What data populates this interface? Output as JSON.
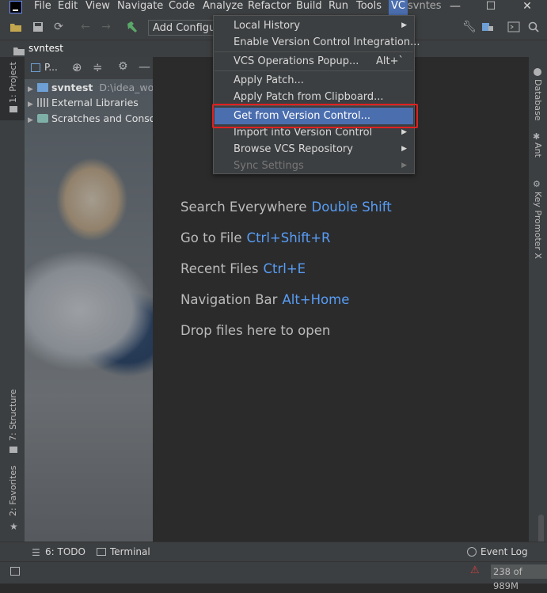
{
  "menubar": {
    "items": [
      "File",
      "Edit",
      "View",
      "Navigate",
      "Code",
      "Analyze",
      "Refactor",
      "Build",
      "Run",
      "Tools",
      "VC"
    ],
    "project_title": "svntes",
    "minimize": "—",
    "maximize": "☐",
    "close": "✕"
  },
  "toolbar": {
    "add_config_label": "Add Configur"
  },
  "breadcrumb": {
    "project": "svntest"
  },
  "left_tabs": {
    "project": "1: Project",
    "structure": "7: Structure",
    "favorites": "2: Favorites"
  },
  "project_pane": {
    "view_label": "P...",
    "tree": [
      {
        "label": "svntest",
        "path": "D:\\idea_work"
      },
      {
        "label": "External Libraries"
      },
      {
        "label": "Scratches and Conso"
      }
    ]
  },
  "editor": {
    "hints": [
      {
        "text": "Search Everywhere",
        "key": "Double Shift"
      },
      {
        "text": "Go to File",
        "key": "Ctrl+Shift+R"
      },
      {
        "text": "Recent Files",
        "key": "Ctrl+E"
      },
      {
        "text": "Navigation Bar",
        "key": "Alt+Home"
      },
      {
        "text": "Drop files here to open",
        "key": ""
      }
    ]
  },
  "right_tabs": {
    "database": "Database",
    "ant": "Ant",
    "key_promoter": "Key Promoter X"
  },
  "vcs_menu": {
    "items": [
      {
        "label": "Local History",
        "submenu": true,
        "shortcut": "",
        "disabled": false,
        "selected": false
      },
      {
        "label": "Enable Version Control Integration...",
        "submenu": false,
        "shortcut": "",
        "disabled": false,
        "selected": false
      },
      {
        "label": "VCS Operations Popup...",
        "submenu": false,
        "shortcut": "Alt+`",
        "disabled": false,
        "selected": false
      },
      {
        "label": "Apply Patch...",
        "submenu": false,
        "shortcut": "",
        "disabled": false,
        "selected": false
      },
      {
        "label": "Apply Patch from Clipboard...",
        "submenu": false,
        "shortcut": "",
        "disabled": false,
        "selected": false
      },
      {
        "label": "Get from Version Control...",
        "submenu": false,
        "shortcut": "",
        "disabled": false,
        "selected": true
      },
      {
        "label": "Import into Version Control",
        "submenu": true,
        "shortcut": "",
        "disabled": false,
        "selected": false
      },
      {
        "label": "Browse VCS Repository",
        "submenu": true,
        "shortcut": "",
        "disabled": false,
        "selected": false
      },
      {
        "label": "Sync Settings",
        "submenu": true,
        "shortcut": "",
        "disabled": true,
        "selected": false
      }
    ]
  },
  "bottom_tabs": {
    "todo": "6: TODO",
    "terminal": "Terminal",
    "event_log": "Event Log"
  },
  "status": {
    "memory": "238 of 989M"
  },
  "colors": {
    "accent": "#4b6eaf",
    "link": "#589df6",
    "highlight_box": "#e02020"
  }
}
